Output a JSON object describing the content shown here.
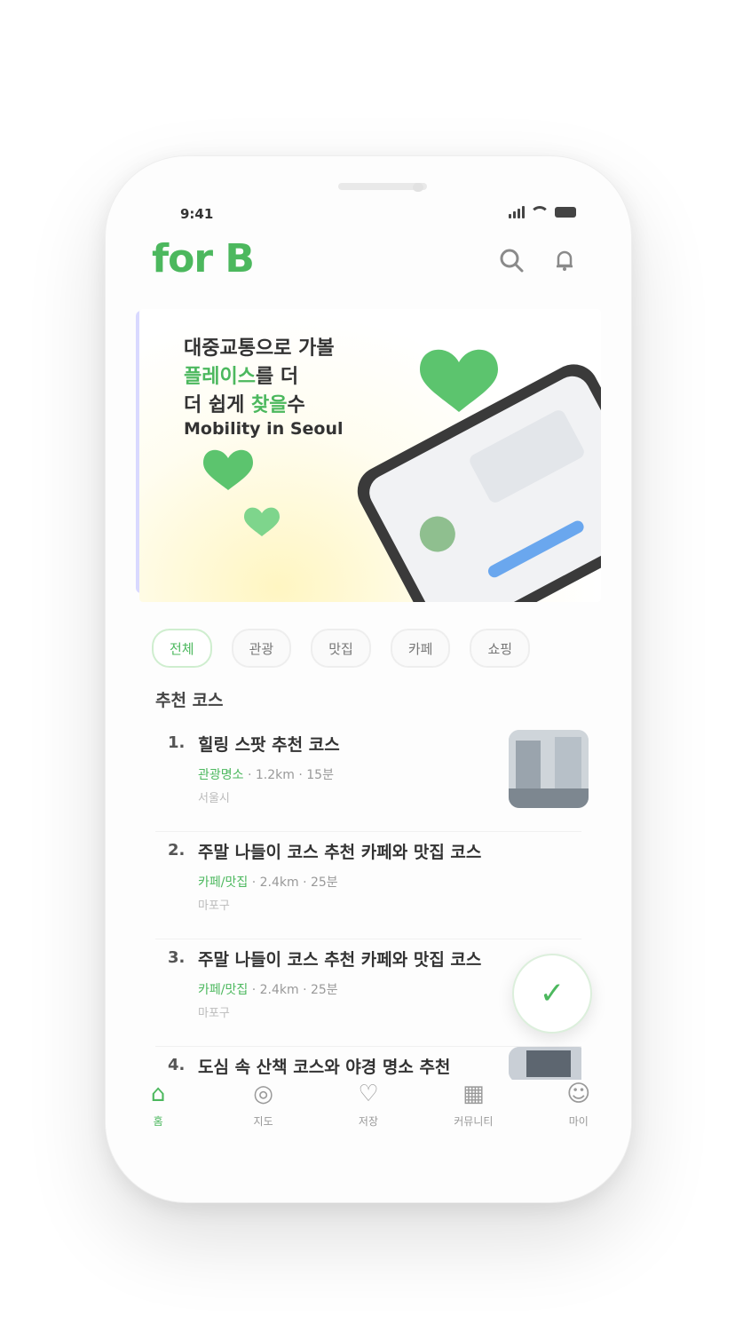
{
  "status_bar": {
    "time": "9:41"
  },
  "header": {
    "logo": "for B"
  },
  "banner": {
    "lines": [
      {
        "pre": "",
        "hl": "",
        "post": "대중교통으로 가볼"
      },
      {
        "pre": "",
        "hl": "플레이스",
        "post": "를 더"
      },
      {
        "pre": "더 쉽게 ",
        "hl": "찾을",
        "post": "수"
      },
      {
        "pre": "",
        "hl": "",
        "post": "Mobility in Seoul"
      }
    ]
  },
  "chips": [
    "전체",
    "관광",
    "맛집",
    "카페",
    "쇼핑"
  ],
  "section_title": "추천 코스",
  "items": [
    {
      "num": "1.",
      "title": "힐링 스팟 추천 코스",
      "cat": "관광명소",
      "dist": "1.2km",
      "time": "15분",
      "sub": "서울시"
    },
    {
      "num": "2.",
      "title": "주말 나들이 코스 추천 카페와 맛집 코스",
      "cat": "카페/맛집",
      "dist": "2.4km",
      "time": "25분",
      "sub": "마포구"
    },
    {
      "num": "3.",
      "title": "주말 나들이 코스 추천 카페와 맛집 코스",
      "cat": "카페/맛집",
      "dist": "2.4km",
      "time": "25분",
      "sub": "마포구"
    },
    {
      "num": "4.",
      "title": "도심 속 산책 코스와 야경 명소 추천",
      "cat": "",
      "dist": "",
      "time": "",
      "sub": ""
    }
  ],
  "tabs": [
    "홈",
    "지도",
    "저장",
    "커뮤니티",
    "마이"
  ],
  "colors": {
    "accent": "#4cb85e"
  }
}
